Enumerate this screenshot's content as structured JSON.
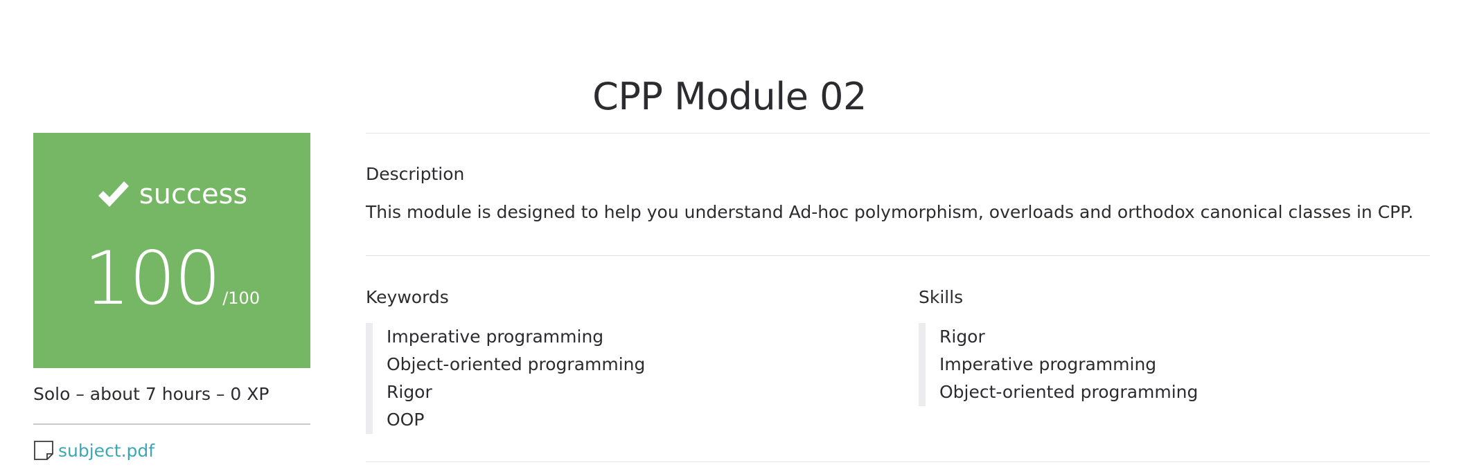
{
  "project": {
    "title": "CPP Module 02"
  },
  "result": {
    "status": "success",
    "score": "100",
    "score_max": "/100",
    "colors": {
      "success_bg": "#75b765",
      "text": "#ffffff"
    },
    "status_icon": "check-icon"
  },
  "meta": {
    "summary": "Solo – about 7 hours – 0 XP"
  },
  "attachment": {
    "icon": "file-icon",
    "label": "subject.pdf",
    "link_color": "#3aa8b4"
  },
  "description": {
    "heading": "Description",
    "text": "This module is designed to help you understand Ad-hoc polymorphism, overloads and orthodox canonical classes in CPP."
  },
  "keywords": {
    "heading": "Keywords",
    "items": [
      "Imperative programming",
      "Object-oriented programming",
      "Rigor",
      "OOP"
    ]
  },
  "skills": {
    "heading": "Skills",
    "items": [
      "Rigor",
      "Imperative programming",
      "Object-oriented programming"
    ]
  }
}
